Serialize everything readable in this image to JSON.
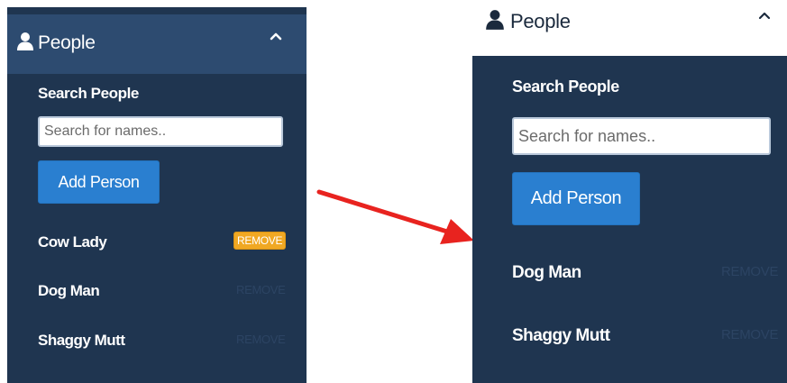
{
  "before": {
    "header": {
      "title": "People",
      "icon": "person-icon",
      "toggle_icon": "chevron-up-icon"
    },
    "search": {
      "label": "Search People",
      "placeholder": "Search for names.."
    },
    "add_button": {
      "label": "Add Person"
    },
    "people": [
      {
        "name": "Cow Lady",
        "action": "REMOVE",
        "highlighted": true
      },
      {
        "name": "Dog Man",
        "action": "REMOVE",
        "highlighted": false
      },
      {
        "name": "Shaggy Mutt",
        "action": "REMOVE",
        "highlighted": false
      }
    ]
  },
  "after": {
    "header": {
      "title": "People",
      "icon": "person-icon",
      "toggle_icon": "chevron-up-icon"
    },
    "search": {
      "label": "Search People",
      "placeholder": "Search for names.."
    },
    "add_button": {
      "label": "Add Person"
    },
    "people": [
      {
        "name": "Dog Man",
        "action": "REMOVE",
        "highlighted": false
      },
      {
        "name": "Shaggy Mutt",
        "action": "REMOVE",
        "highlighted": false
      }
    ]
  },
  "colors": {
    "panel_bg": "#1f3550",
    "header_bg": "#2d4b70",
    "primary_button": "#2a7fd0",
    "remove_highlight": "#f0a823",
    "remove_muted": "#2c4463",
    "arrow": "#e8231f"
  }
}
